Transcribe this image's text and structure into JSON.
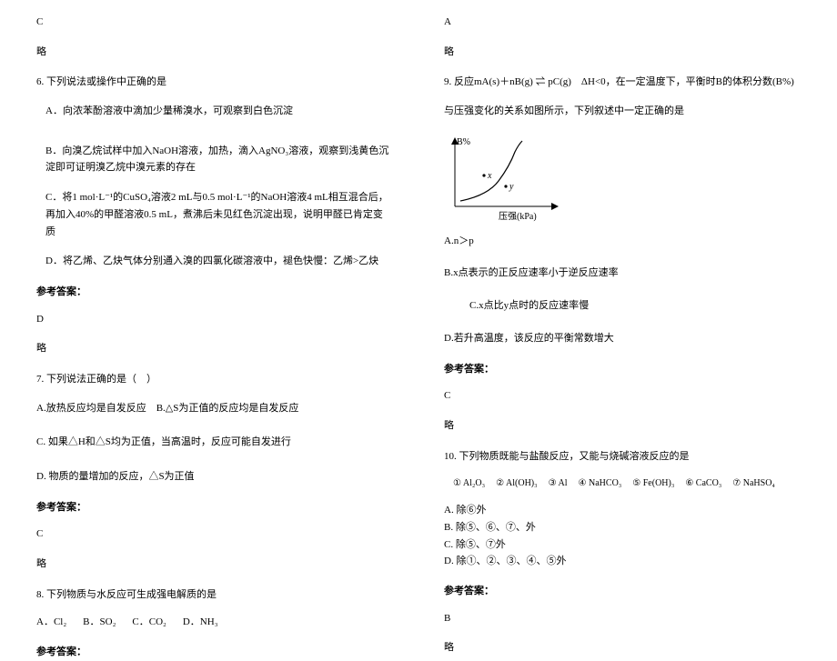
{
  "left": {
    "ans5": "C",
    "skip5": "略",
    "q6": {
      "stem": "6. 下列说法或操作中正确的是",
      "A": "A．向浓苯酚溶液中滴加少量稀溴水，可观察到白色沉淀",
      "B": "B．向溴乙烷试样中加入NaOH溶液，加热，滴入AgNO₃溶液，观察到浅黄色沉淀即可证明溴乙烷中溴元素的存在",
      "C": "C．将1 mol·L⁻¹的CuSO₄溶液2 mL与0.5 mol·L⁻¹的NaOH溶液4 mL相互混合后，再加入40%的甲醛溶液0.5 mL，煮沸后未见红色沉淀出现，说明甲醛已肯定变质",
      "D": "D．将乙烯、乙炔气体分别通入溴的四氯化碳溶液中，褪色快慢：乙烯>乙炔",
      "ansLabel": "参考答案：",
      "ans": "D",
      "skip": "略"
    },
    "q7": {
      "stem": "7. 下列说法正确的是（　）",
      "A": "A.放热反应均是自发反应",
      "B": "B.△S为正值的反应均是自发反应",
      "C": "C. 如果△H和△S均为正值，当高温时，反应可能自发进行",
      "D": "D. 物质的量增加的反应，△S为正值",
      "ansLabel": "参考答案：",
      "ans": "C",
      "skip": "略"
    },
    "q8": {
      "stem": "8. 下列物质与水反应可生成强电解质的是",
      "A": "A．Cl₂",
      "B": "B．SO₂",
      "C": "C．CO₂",
      "D": "D．NH₃",
      "ansLabel": "参考答案："
    }
  },
  "right": {
    "ans8": "A",
    "skip8": "略",
    "q9": {
      "stem1": "9. 反应mA(s)＋nB(g) ⇌ pC(g)　ΔH<0，在一定温度下，平衡时B的体积分数(B%)",
      "stem2": "与压强变化的关系如图所示，下列叙述中一定正确的是",
      "A": "A.n＞p",
      "B": "B.x点表示的正反应速率小于逆反应速率",
      "C": "C.x点比y点时的反应速率慢",
      "D": "D.若升高温度，该反应的平衡常数增大",
      "ansLabel": "参考答案：",
      "ans": "C",
      "skip": "略"
    },
    "chart": {
      "yLabel": "B%",
      "xLabel": "压强(kPa)",
      "ptX": "x",
      "ptY": "y"
    },
    "q10": {
      "stem": "10. 下列物质既能与盐酸反应，又能与烧碱溶液反应的是",
      "o1": "① Al₂O₃",
      "o2": "② Al(OH)₃",
      "o3": "③ Al",
      "o4": "④ NaHCO₃",
      "o5": "⑤ Fe(OH)₃",
      "o6": "⑥ CaCO₃",
      "o7": "⑦ NaHSO₄",
      "A": "A. 除⑥外",
      "B": "B. 除⑤、⑥、⑦、外",
      "C": "C. 除⑤、⑦外",
      "D": "D. 除①、②、③、④、⑤外",
      "ansLabel": "参考答案：",
      "ans": "B",
      "skip": "略"
    }
  }
}
